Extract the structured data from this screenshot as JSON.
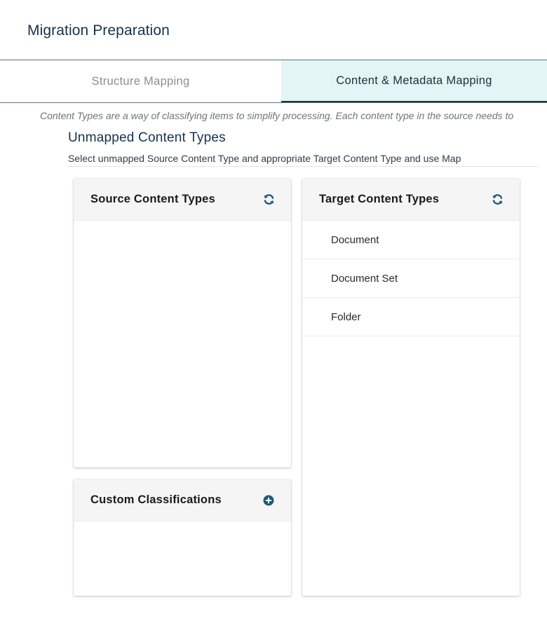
{
  "page": {
    "title": "Migration Preparation"
  },
  "tabs": [
    {
      "label": "Structure Mapping",
      "active": false
    },
    {
      "label": "Content & Metadata Mapping",
      "active": true
    }
  ],
  "intro_text": "Content Types are a way of classifying items to simplify processing.  Each content type in the source needs to",
  "section": {
    "title": "Unmapped Content Types",
    "subtitle": "Select unmapped Source Content Type and appropriate Target Content Type and use Map"
  },
  "source_panel": {
    "title": "Source Content Types",
    "icon": "refresh-icon",
    "items": []
  },
  "target_panel": {
    "title": "Target Content Types",
    "icon": "refresh-icon",
    "items": [
      "Document",
      "Document Set",
      "Folder"
    ]
  },
  "custom_panel": {
    "title": "Custom Classifications",
    "icon": "add-circle-icon",
    "items": []
  },
  "colors": {
    "accent": "#17324a",
    "icon": "#1b5a78",
    "active_tab_bg": "#e3f5f4",
    "panel_header_bg": "#f5f5f5"
  }
}
